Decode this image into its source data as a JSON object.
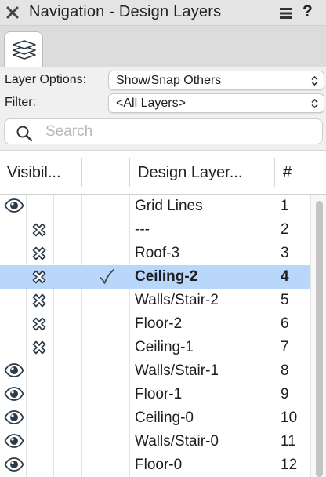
{
  "window": {
    "title": "Navigation - Design Layers",
    "close_icon": "close-icon",
    "menu_icon": "hamburger-menu-icon",
    "help_label": "?"
  },
  "tabs": [
    {
      "icon": "layers-icon",
      "active": true
    }
  ],
  "options": {
    "layer_options_label": "Layer Options:",
    "layer_options_value": "Show/Snap Others",
    "filter_label": "Filter:",
    "filter_value": "<All Layers>"
  },
  "search": {
    "placeholder": "Search",
    "value": ""
  },
  "table": {
    "headers": {
      "visibility": "Visibil...",
      "name": "Design Layer...",
      "number": "#"
    },
    "rows": [
      {
        "visibility": "visible",
        "active": false,
        "name": "Grid Lines",
        "number": "1"
      },
      {
        "visibility": "hidden",
        "active": false,
        "name": "---",
        "number": "2"
      },
      {
        "visibility": "hidden",
        "active": false,
        "name": "Roof-3",
        "number": "3"
      },
      {
        "visibility": "hidden",
        "active": true,
        "name": "Ceiling-2",
        "number": "4"
      },
      {
        "visibility": "hidden",
        "active": false,
        "name": "Walls/Stair-2",
        "number": "5"
      },
      {
        "visibility": "hidden",
        "active": false,
        "name": "Floor-2",
        "number": "6"
      },
      {
        "visibility": "hidden",
        "active": false,
        "name": "Ceiling-1",
        "number": "7"
      },
      {
        "visibility": "visible",
        "active": false,
        "name": "Walls/Stair-1",
        "number": "8"
      },
      {
        "visibility": "visible",
        "active": false,
        "name": "Floor-1",
        "number": "9"
      },
      {
        "visibility": "visible",
        "active": false,
        "name": "Ceiling-0",
        "number": "10"
      },
      {
        "visibility": "visible",
        "active": false,
        "name": "Walls/Stair-0",
        "number": "11"
      },
      {
        "visibility": "visible",
        "active": false,
        "name": "Floor-0",
        "number": "12"
      }
    ]
  },
  "colors": {
    "selection": "#b9d6fb",
    "icon": "#2c3a47"
  }
}
